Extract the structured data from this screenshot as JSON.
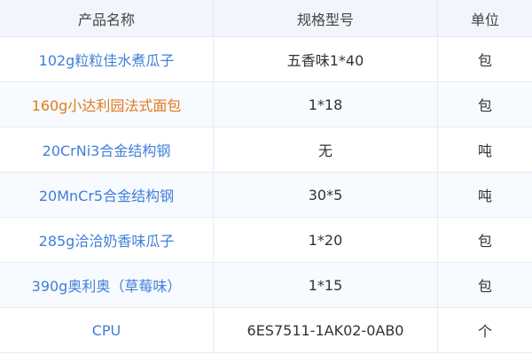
{
  "table": {
    "headers": [
      "产品名称",
      "规格型号",
      "单位"
    ],
    "rows": [
      {
        "name": "102g粒粒佳水煮瓜子",
        "spec": "五香味1*40",
        "unit": "包"
      },
      {
        "name": "160g小达利园法式面包",
        "spec": "1*18",
        "unit": "包"
      },
      {
        "name": "20CrNi3合金结构钢",
        "spec": "无",
        "unit": "吨"
      },
      {
        "name": "20MnCr5合金结构钢",
        "spec": "30*5",
        "unit": "吨"
      },
      {
        "name": "285g洽洽奶香味瓜子",
        "spec": "1*20",
        "unit": "包"
      },
      {
        "name": "390g奥利奥（草莓味）",
        "spec": "1*15",
        "unit": "包"
      },
      {
        "name": "CPU",
        "spec": "6ES7511-1AK02-0AB0",
        "unit": "个"
      }
    ]
  },
  "colors": {
    "link": "#3f7fd8",
    "link_hover": "#e27a1c",
    "header_bg": "#f1f6fd",
    "alt_row_bg": "#f7faff",
    "border": "#e7eaf0"
  }
}
